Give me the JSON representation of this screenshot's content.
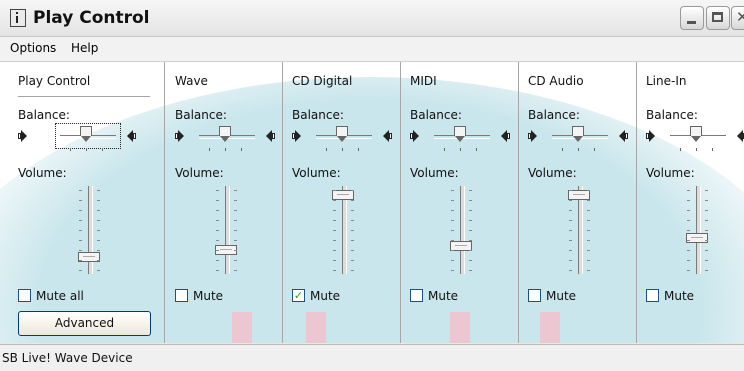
{
  "window": {
    "title": "Play Control"
  },
  "menu": {
    "items": [
      "Options",
      "Help"
    ]
  },
  "columns": [
    {
      "title": "Play Control",
      "balance_label": "Balance:",
      "volume_label": "Volume:",
      "volume_level": 0.15,
      "mute_label": "Mute all",
      "muted": false
    },
    {
      "title": "Wave",
      "balance_label": "Balance:",
      "volume_label": "Volume:",
      "volume_level": 0.25,
      "mute_label": "Mute",
      "muted": false
    },
    {
      "title": "CD Digital",
      "balance_label": "Balance:",
      "volume_label": "Volume:",
      "volume_level": 0.95,
      "mute_label": "Mute",
      "muted": true
    },
    {
      "title": "MIDI",
      "balance_label": "Balance:",
      "volume_label": "Volume:",
      "volume_level": 0.3,
      "mute_label": "Mute",
      "muted": false
    },
    {
      "title": "CD Audio",
      "balance_label": "Balance:",
      "volume_label": "Volume:",
      "volume_level": 0.95,
      "mute_label": "Mute",
      "muted": false
    },
    {
      "title": "Line-In",
      "balance_label": "Balance:",
      "volume_label": "Volume:",
      "volume_level": 0.4,
      "mute_label": "Mute",
      "muted": false
    }
  ],
  "advanced_button": {
    "label": "Advanced"
  },
  "status_bar": {
    "text": "SB Live! Wave Device"
  },
  "colors": {
    "background_tint": "#c9e6ec",
    "focus_outline": "#222222",
    "checkbox_border": "#1c5180",
    "check_mark": "#21a121"
  }
}
